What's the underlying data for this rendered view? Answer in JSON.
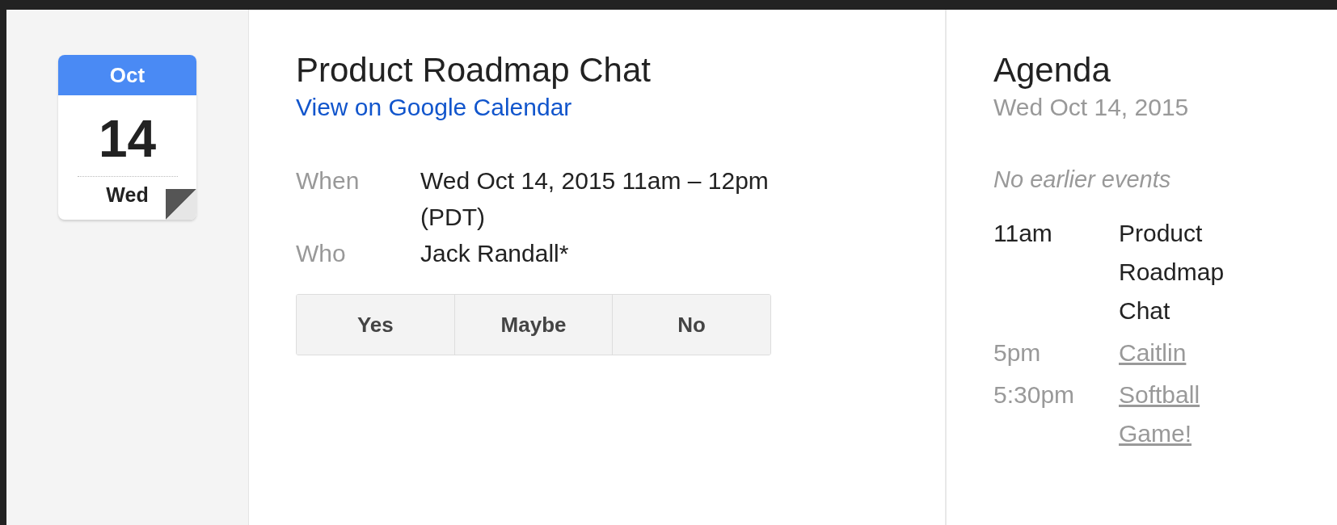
{
  "date_icon": {
    "month": "Oct",
    "day": "14",
    "weekday": "Wed"
  },
  "event": {
    "title": "Product Roadmap Chat",
    "link": "View on Google Calendar",
    "details": [
      {
        "label": "When",
        "value": "Wed Oct 14, 2015 11am – 12pm (PDT)"
      },
      {
        "label": "Who",
        "value": "Jack Randall*"
      }
    ],
    "rsvp_buttons": [
      "Yes",
      "Maybe",
      "No"
    ]
  },
  "agenda": {
    "title": "Agenda",
    "date": "Wed Oct 14, 2015",
    "note": "No earlier events",
    "events": [
      {
        "time": "11am",
        "title": "Product Roadmap Chat",
        "current": true
      },
      {
        "time": "5pm",
        "title": "Caitlin",
        "current": false
      },
      {
        "time": "5:30pm",
        "title": "Softball Game!",
        "current": false
      }
    ]
  }
}
